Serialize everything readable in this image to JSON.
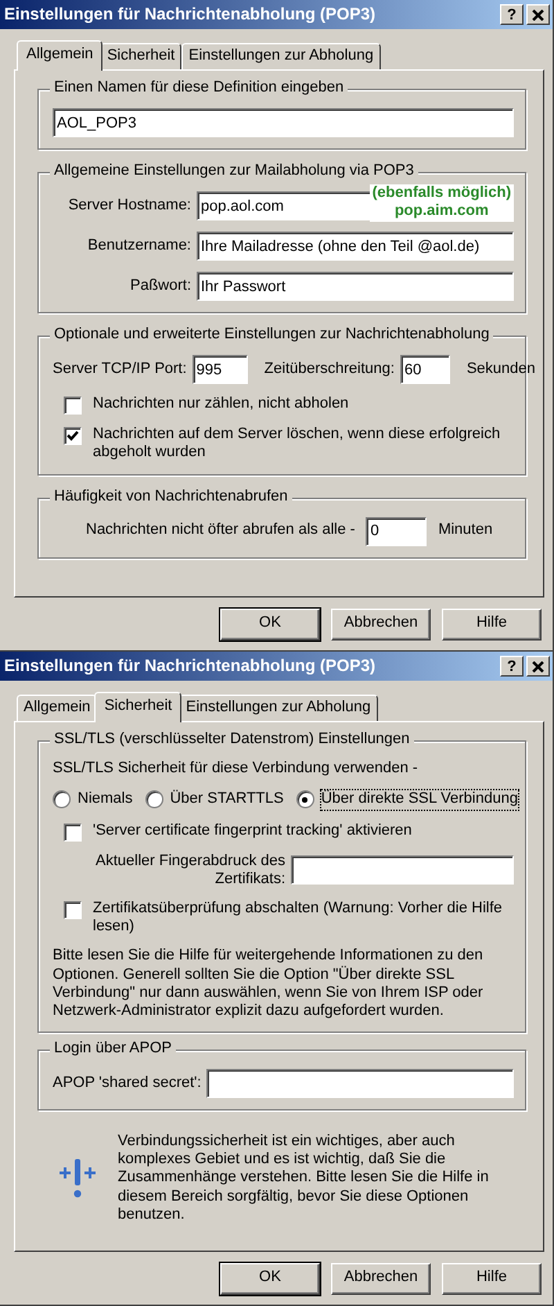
{
  "dialogs": [
    {
      "title": "Einstellungen für Nachrichtenabholung (POP3)",
      "help": "?",
      "tabs": [
        {
          "label": "Allgemein",
          "selected": true
        },
        {
          "label": "Sicherheit",
          "selected": false
        },
        {
          "label": "Einstellungen zur Abholung",
          "selected": false
        }
      ],
      "panel": [
        {
          "kind": "group",
          "title": "Einen Namen für diese Definition eingeben",
          "rows": [
            {
              "kind": "input",
              "value": "AOL_POP3"
            }
          ]
        },
        {
          "kind": "group",
          "title": "Allgemeine Einstellungen zur Mailabholung via POP3",
          "annotation": [
            "(ebenfalls möglich)",
            "pop.aim.com"
          ],
          "rows": [
            {
              "kind": "field",
              "label": "Server Hostname:",
              "value": "pop.aol.com"
            },
            {
              "kind": "field",
              "label": "Benutzername:",
              "value": "Ihre Mailadresse (ohne den Teil @aol.de)"
            },
            {
              "kind": "field",
              "label": "Paßwort:",
              "value": "Ihr Passwort"
            }
          ]
        },
        {
          "kind": "group",
          "title": "Optionale und erweiterte Einstellungen zur Nachrichtenabholung",
          "rows": [
            {
              "kind": "pair",
              "label": "Server TCP/IP Port:",
              "value": "995",
              "label_2": "Zeitüberschreitung:",
              "value_2": "60",
              "unit": "Sekunden"
            },
            {
              "kind": "checkbox",
              "label": "Nachrichten nur zählen, nicht abholen",
              "checked": false
            },
            {
              "kind": "checkbox",
              "label": "Nachrichten auf dem Server löschen, wenn diese erfolgreich abgeholt wurden",
              "checked": true
            }
          ]
        },
        {
          "kind": "group",
          "title": "Häufigkeit von Nachrichtenabrufen",
          "rows": [
            {
              "kind": "inline_field",
              "label": "Nachrichten nicht öfter abrufen als alle -",
              "value": "0",
              "unit": "Minuten"
            }
          ]
        }
      ],
      "buttons": [
        {
          "label": "OK",
          "default": true
        },
        {
          "label": "Abbrechen",
          "default": false
        },
        {
          "label": "Hilfe",
          "default": false
        }
      ]
    },
    {
      "title": "Einstellungen für Nachrichtenabholung (POP3)",
      "help": "?",
      "tabs": [
        {
          "label": "Allgemein",
          "selected": false
        },
        {
          "label": "Sicherheit",
          "selected": true
        },
        {
          "label": "Einstellungen zur Abholung",
          "selected": false
        }
      ],
      "panel": [
        {
          "kind": "group",
          "title": "SSL/TLS (verschlüsselter Datenstrom) Einstellungen",
          "rows": [
            {
              "kind": "text",
              "text": "SSL/TLS Sicherheit für diese Verbindung verwenden -"
            },
            {
              "kind": "radios",
              "options": [
                {
                  "label": "Niemals",
                  "selected": false
                },
                {
                  "label": "Über STARTTLS",
                  "selected": false
                },
                {
                  "label": "Über direkte SSL Verbindung",
                  "selected": true
                }
              ]
            },
            {
              "kind": "checkbox",
              "label": "'Server certificate fingerprint tracking' aktivieren",
              "checked": false
            },
            {
              "kind": "field",
              "label": "Aktueller Fingerabdruck des Zertifikats:"
            },
            {
              "kind": "checkbox",
              "label": "Zertifikatsüberprüfung abschalten (Warnung: Vorher die Hilfe lesen)",
              "checked": false
            },
            {
              "kind": "text",
              "text": "Bitte lesen Sie die Hilfe für weitergehende Informationen zu den Optionen. Generell sollten Sie die Option \"Über direkte SSL Verbindung\" nur dann auswählen, wenn Sie von Ihrem ISP oder Netzwerk-Administrator explizit dazu aufgefordert wurden."
            }
          ]
        },
        {
          "kind": "group",
          "title": "Login über APOP",
          "rows": [
            {
              "kind": "field",
              "label": "APOP 'shared secret':"
            }
          ]
        },
        {
          "kind": "info",
          "text": "Verbindungssicherheit ist ein wichtiges, aber auch komplexes Gebiet und es ist wichtig, daß Sie die Zusammenhänge verstehen. Bitte lesen Sie die Hilfe in diesem Bereich sorgfältig, bevor Sie diese Optionen benutzen."
        }
      ],
      "buttons": [
        {
          "label": "OK",
          "default": true
        },
        {
          "label": "Abbrechen",
          "default": false
        },
        {
          "label": "Hilfe",
          "default": false
        }
      ]
    }
  ]
}
